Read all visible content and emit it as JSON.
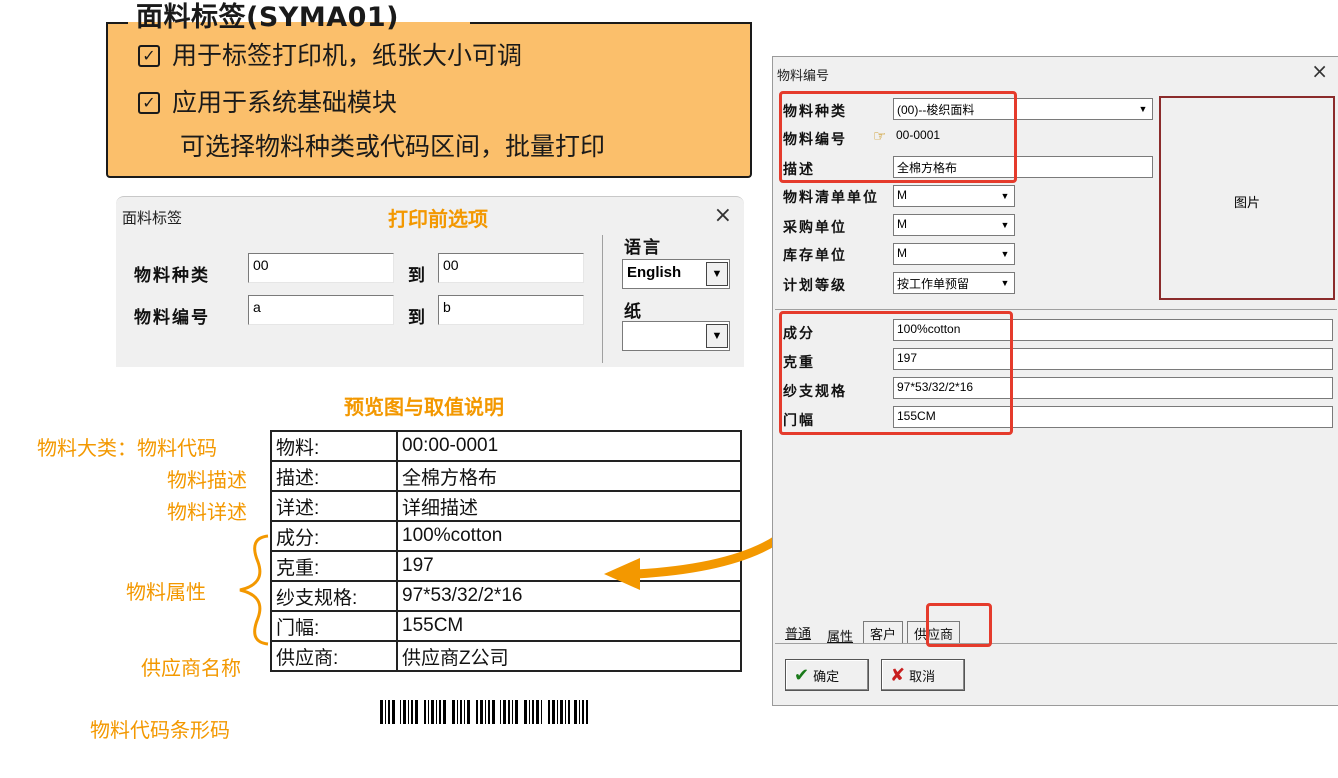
{
  "callout": {
    "title": "面料标签(SYMA01)",
    "features": [
      "用于标签打印机，纸张大小可调",
      "应用于系统基础模块",
      "可选择物料种类或代码区间，批量打印"
    ],
    "check_glyph": "✓"
  },
  "print_dialog": {
    "title": "面料标签",
    "heading": "打印前选项",
    "close": "×",
    "rows": [
      {
        "label": "物料种类",
        "from": "00",
        "to_label": "到",
        "to": "00"
      },
      {
        "label": "物料编号",
        "from": "a",
        "to_label": "到",
        "to": "b"
      }
    ],
    "language_label": "语言",
    "language_value": "English",
    "paper_label": "纸",
    "paper_value": "",
    "dropdown_glyph": "▼"
  },
  "preview": {
    "heading": "预览图与取值说明",
    "side_labels": {
      "category_code": "物料大类：物料代码",
      "description": "物料描述",
      "detail": "物料详述",
      "attributes": "物料属性",
      "supplier": "供应商名称",
      "barcode": "物料代码条形码"
    },
    "rows": [
      {
        "key": "物料:",
        "value": "00:00-0001"
      },
      {
        "key": "描述:",
        "value": "全棉方格布"
      },
      {
        "key": "详述:",
        "value": "详细描述"
      },
      {
        "key": "成分:",
        "value": "100%cotton"
      },
      {
        "key": "克重:",
        "value": "197"
      },
      {
        "key": "纱支规格:",
        "value": "97*53/32/2*16"
      },
      {
        "key": "门幅:",
        "value": "155CM"
      },
      {
        "key": "供应商:",
        "value": "供应商Z公司"
      }
    ]
  },
  "material_dialog": {
    "title": "物料编号",
    "close": "×",
    "fields": {
      "category": {
        "label": "物料种类",
        "value": "(00)--梭织面料"
      },
      "code": {
        "label": "物料编号",
        "value": "00-0001"
      },
      "description": {
        "label": "描述",
        "value": "全棉方格布"
      },
      "bom_unit": {
        "label": "物料清单单位",
        "value": "M"
      },
      "purchase_unit": {
        "label": "采购单位",
        "value": "M"
      },
      "stock_unit": {
        "label": "库存单位",
        "value": "M"
      },
      "plan_level": {
        "label": "计划等级",
        "value": "按工作单预留"
      }
    },
    "picture_label": "图片",
    "attributes": [
      {
        "label": "成分",
        "value": "100%cotton"
      },
      {
        "label": "克重",
        "value": "197"
      },
      {
        "label": "纱支规格",
        "value": "97*53/32/2*16"
      },
      {
        "label": "门幅",
        "value": "155CM"
      }
    ],
    "tabs": [
      "普通",
      "属性",
      "客户",
      "供应商"
    ],
    "ok_label": "确定",
    "cancel_label": "取消",
    "ok_glyph": "✔",
    "cancel_glyph": "✘",
    "pointer_glyph": "☞",
    "dropdown_glyph": "▼"
  },
  "colors": {
    "accent": "#f39800",
    "callout_bg": "#fbbf6b",
    "highlight": "#e53b2c"
  }
}
